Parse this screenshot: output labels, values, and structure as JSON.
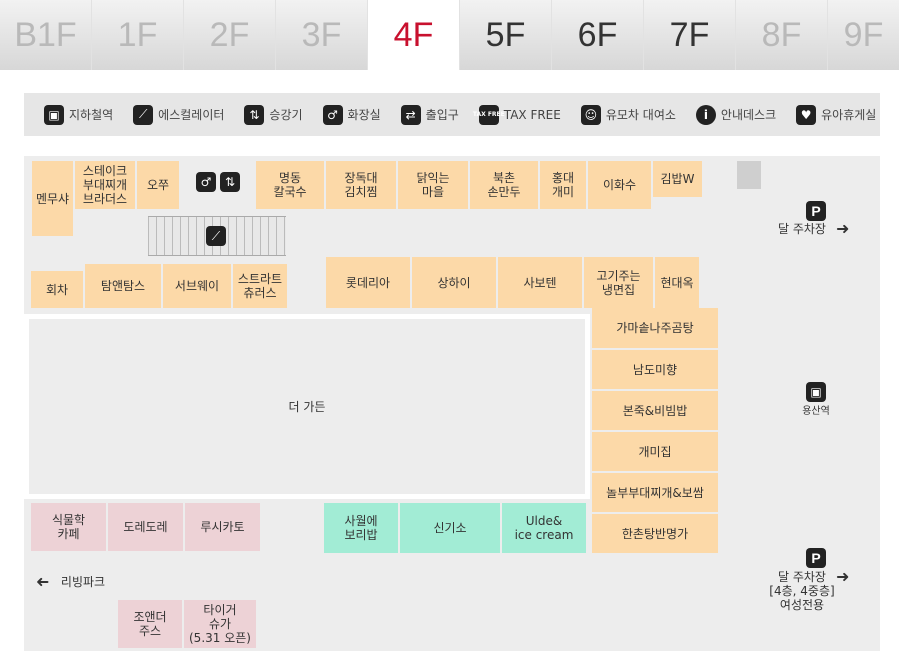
{
  "floors": [
    {
      "label": "B1F",
      "state": "dim"
    },
    {
      "label": "1F",
      "state": "dim"
    },
    {
      "label": "2F",
      "state": "dim"
    },
    {
      "label": "3F",
      "state": "dim"
    },
    {
      "label": "4F",
      "state": "active"
    },
    {
      "label": "5F",
      "state": "normal"
    },
    {
      "label": "6F",
      "state": "normal"
    },
    {
      "label": "7F",
      "state": "normal"
    },
    {
      "label": "8F",
      "state": "dim"
    },
    {
      "label": "9F",
      "state": "dim"
    }
  ],
  "legend": {
    "subway": "지하철역",
    "escalator": "에스컬레이터",
    "elevator": "승강기",
    "restroom": "화장실",
    "entrance": "출입구",
    "tax_free": "TAX FREE",
    "tax_icon_text": "TAX FREE",
    "stroller": "유모차 대여소",
    "info": "안내데스크",
    "nursing": "유아휴게실"
  },
  "stores": {
    "menusha": "멘무샤",
    "steak_budae": "스테이크\n부대찌개\n브라더스",
    "ojju": "오쭈",
    "myeongdong": "명동\n칼국수",
    "jangdokdae": "장독대\n김치찜",
    "dak": "닭익는\n마을",
    "bukchon": "북촌\n손만두",
    "hongdae": "홍대\n개미",
    "ewhasu": "이화수",
    "gimbap": "김밥W",
    "hoecha": "회차",
    "taman": "탐앤탐스",
    "subway_store": "서브웨이",
    "churros": "스트라트\n츄러스",
    "lotteria": "롯데리아",
    "shanghai": "상하이",
    "saboten": "사보텐",
    "gogi": "고기주는\n냉면집",
    "hyundaeok": "현대옥",
    "gama": "가마솥나주곰탕",
    "namdo": "남도미향",
    "bonjuk": "본죽&비빔밥",
    "gaemi": "개미집",
    "nolbu": "놀부부대찌개&보쌈",
    "hanchon": "한촌탕반명가",
    "garden": "더 가든",
    "botanic": "식물학\n카페",
    "doredore": "도레도레",
    "lusi": "루시카토",
    "sawol": "사월에\n보리밥",
    "shingiso": "신기소",
    "ulde": "Ulde&\nice cream",
    "joe": "조앤더\n주스",
    "tiger": "타이거\n슈가\n(5.31 오픈)"
  },
  "map_labels": {
    "parking_top": "달 주차장",
    "station": "용산역",
    "parking_bottom": "달 주차장\n[4층, 4중층]\n여성전용",
    "living_park": "리빙파크",
    "parking_icon": "P"
  }
}
